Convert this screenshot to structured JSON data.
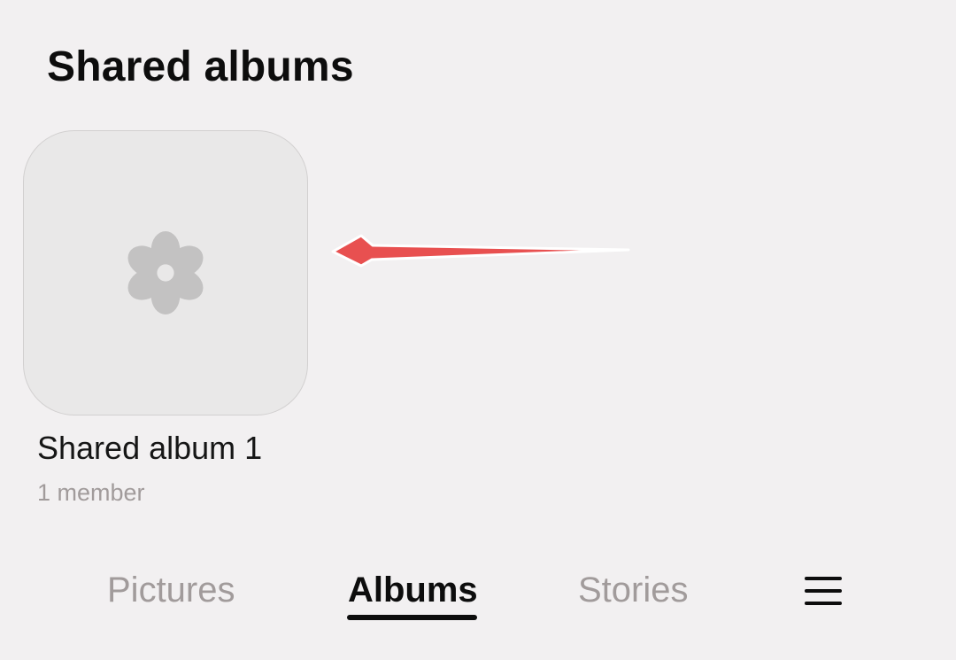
{
  "header": {
    "title": "Shared albums"
  },
  "albums": [
    {
      "name": "Shared album 1",
      "members": "1 member",
      "thumbnail_icon": "flower-placeholder-icon"
    }
  ],
  "annotation": {
    "icon": "red-arrow-icon",
    "color": "#e85050"
  },
  "bottom_nav": {
    "tabs": [
      {
        "label": "Pictures",
        "active": false
      },
      {
        "label": "Albums",
        "active": true
      },
      {
        "label": "Stories",
        "active": false
      }
    ],
    "menu_icon": "hamburger-menu-icon"
  },
  "colors": {
    "background": "#f2f0f1",
    "thumbnail_bg": "#e9e8e8",
    "placeholder_icon": "#c3c2c2",
    "inactive_text": "#a19b9b",
    "active_text": "#0d0d0d"
  }
}
